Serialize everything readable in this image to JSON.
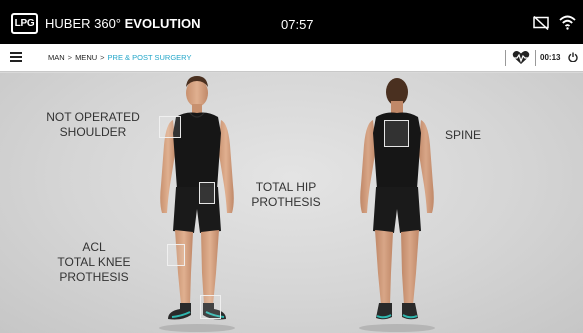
{
  "header": {
    "logo_text": "LPG",
    "app_name_prefix": "HUBER 360°",
    "app_name_suffix": "EVOLUTION",
    "time": "07:57",
    "status_icons": [
      "screen-off-icon",
      "wifi-icon"
    ]
  },
  "breadcrumb": {
    "items": [
      "MAN",
      "MENU"
    ],
    "separator": ">",
    "current": "PRE & POST SURGERY",
    "session_timer": "00:13"
  },
  "zones": {
    "shoulder": {
      "lines": [
        "NOT OPERATED",
        "SHOULDER"
      ]
    },
    "hip": {
      "lines": [
        "TOTAL HIP",
        "PROTHESIS"
      ]
    },
    "knee": {
      "lines": [
        "ACL",
        "TOTAL KNEE",
        "PROTHESIS"
      ]
    },
    "spine": {
      "lines": [
        "SPINE"
      ]
    }
  },
  "colors": {
    "header_bg": "#000000",
    "accent": "#22a6c9",
    "stage_bg": "#d9d9d9",
    "outfit": "#161616",
    "skin": "#d9a888",
    "shoe_accent": "#2fb8b0"
  }
}
